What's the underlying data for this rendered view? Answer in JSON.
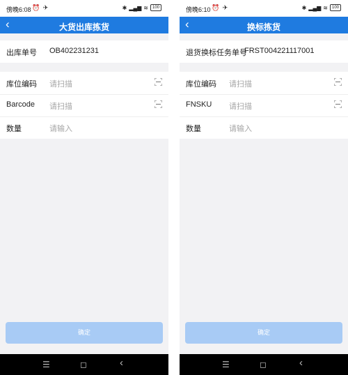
{
  "left": {
    "status": {
      "time": "傍晚6:08",
      "battery": "100"
    },
    "header": {
      "back": "‹",
      "title": "大货出库拣货"
    },
    "order": {
      "label": "出库单号",
      "value": "OB402231231"
    },
    "fields": [
      {
        "label": "库位编码",
        "placeholder": "请扫描"
      },
      {
        "label": "Barcode",
        "placeholder": "请扫描"
      },
      {
        "label": "数量",
        "placeholder": "请输入"
      }
    ],
    "confirm": "确定"
  },
  "right": {
    "status": {
      "time": "傍晚6:10",
      "battery": "100"
    },
    "header": {
      "back": "‹",
      "title": "换标拣货"
    },
    "order": {
      "label": "退货换标任务单号",
      "value": "FRST004221117001"
    },
    "fields": [
      {
        "label": "库位编码",
        "placeholder": "请扫描"
      },
      {
        "label": "FNSKU",
        "placeholder": "请扫描"
      },
      {
        "label": "数量",
        "placeholder": "请输入"
      }
    ],
    "confirm": "确定"
  },
  "nav": {
    "menu": "☰",
    "home": "◻",
    "back": "‹"
  },
  "colors": {
    "accent": "#1f7be0",
    "button": "#a8cbf5"
  },
  "icons": [
    "wifi-icon",
    "signal-icon",
    "bluetooth-icon",
    "alarm-icon",
    "scan-icon",
    "back-icon"
  ]
}
